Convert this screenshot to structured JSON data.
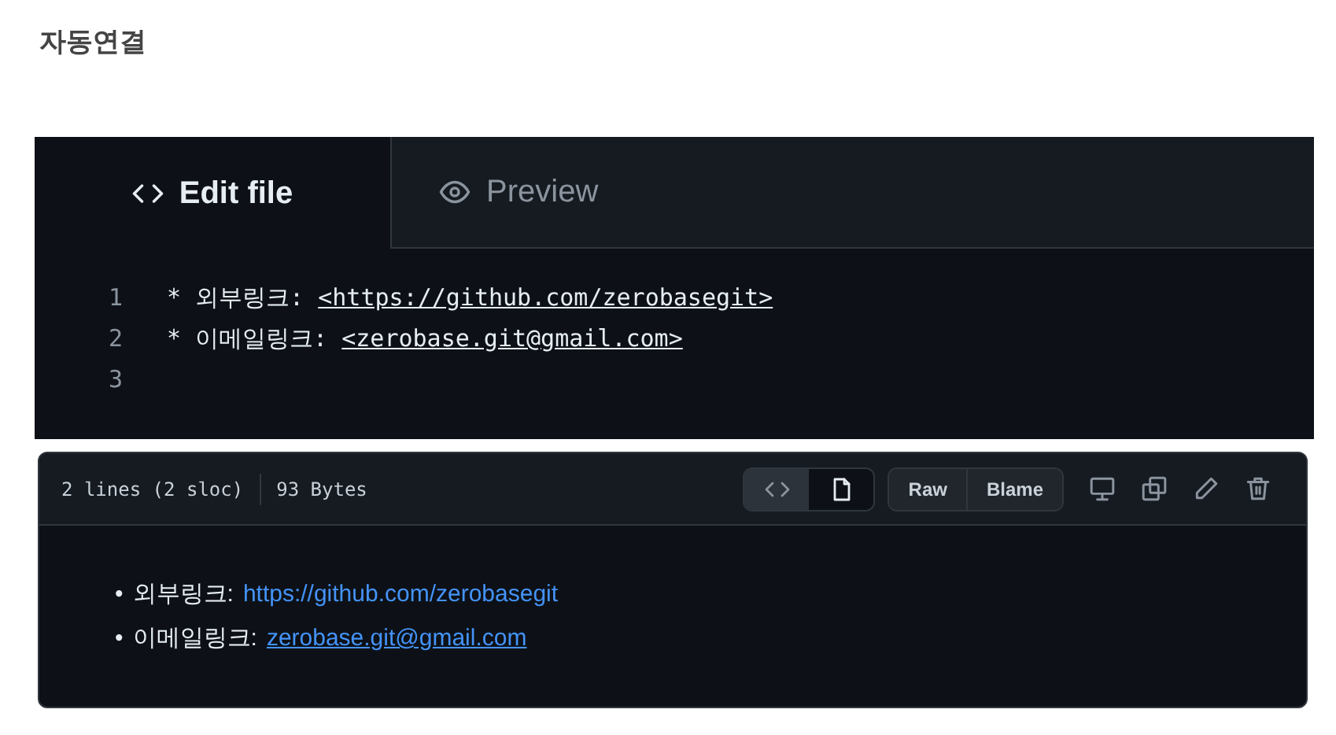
{
  "heading": "자동연결",
  "editor": {
    "tabs": [
      {
        "label": "Edit file",
        "selected": true
      },
      {
        "label": "Preview",
        "selected": false
      }
    ],
    "lines": [
      {
        "number": "1",
        "prefix": "* 외부링크: ",
        "link": "<https://github.com/zerobasegit>"
      },
      {
        "number": "2",
        "prefix": "* 이메일링크: ",
        "link": "<zerobase.git@gmail.com>"
      },
      {
        "number": "3"
      }
    ]
  },
  "viewer": {
    "info": [
      "2 lines (2 sloc)",
      "93 Bytes"
    ],
    "view_toggles": [
      {
        "selected": false
      },
      {
        "selected": true
      }
    ],
    "buttons": [
      "Raw",
      "Blame"
    ],
    "items": [
      {
        "marker": "•",
        "label": "외부링크:",
        "link": "https://github.com/zerobasegit",
        "underlined": false
      },
      {
        "marker": "•",
        "label": "이메일링크:",
        "link": "zerobase.git@gmail.com",
        "underlined": true
      }
    ]
  }
}
